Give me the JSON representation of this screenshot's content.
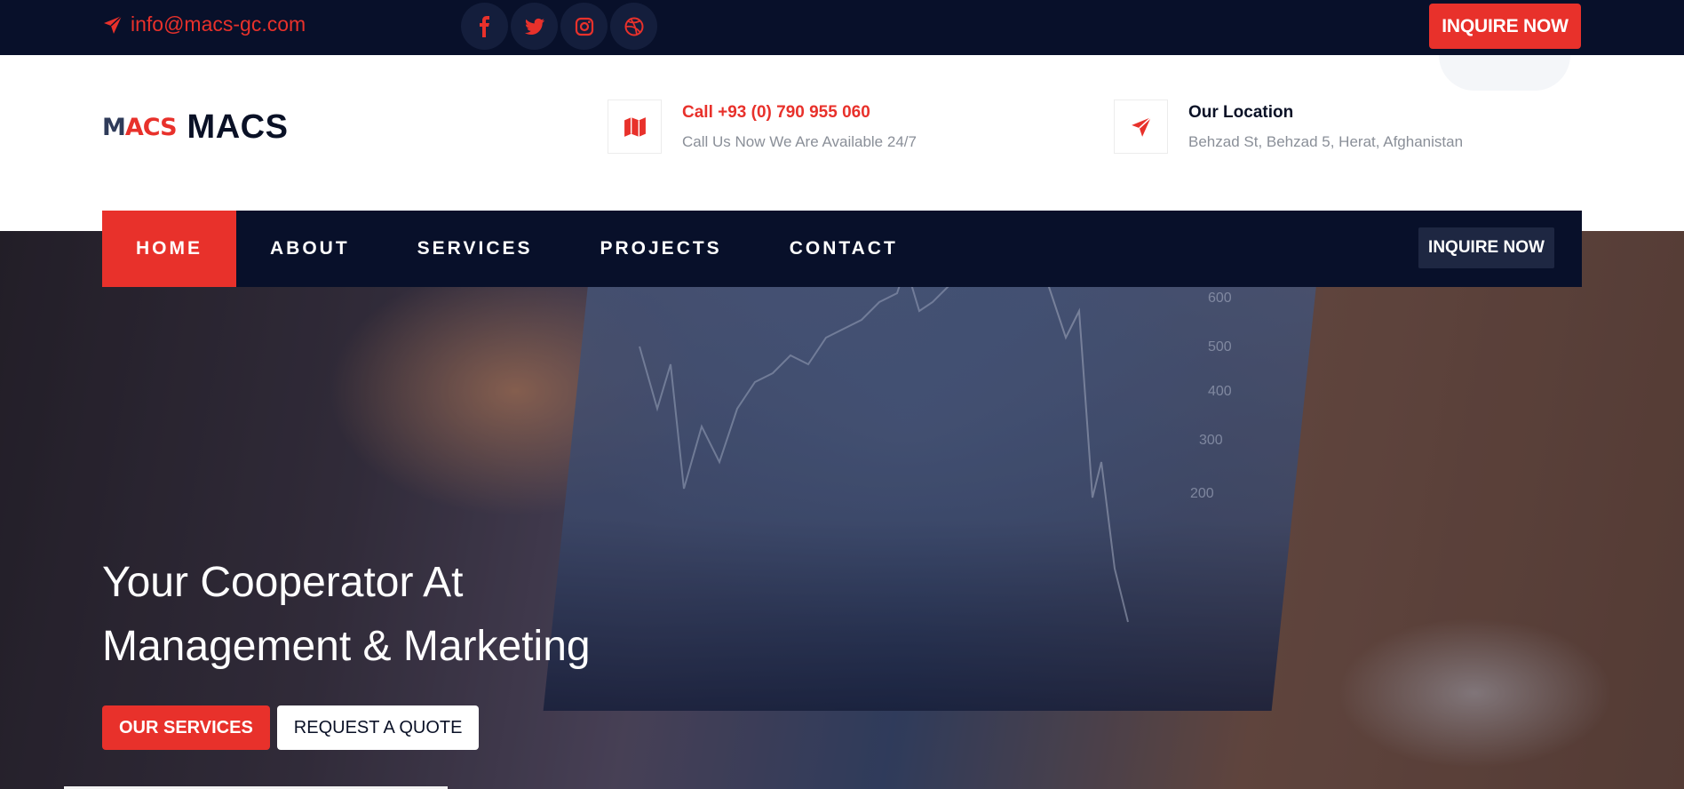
{
  "topbar": {
    "email": "info@macs-gc.com",
    "social_icons": [
      "facebook-icon",
      "twitter-icon",
      "instagram-icon",
      "dribbble-icon"
    ],
    "inquire_label": "INQUIRE NOW"
  },
  "header": {
    "logo_mark_m": "M",
    "logo_mark_acs": "ACS",
    "logo_text": "MACS",
    "call": {
      "icon": "map-icon",
      "title": "Call +93 (0) 790 955 060",
      "subtitle": "Call Us Now We Are Available 24/7"
    },
    "location": {
      "icon": "paper-plane-icon",
      "title": "Our Location",
      "subtitle": "Behzad St, Behzad 5, Herat, Afghanistan"
    }
  },
  "nav": {
    "items": [
      {
        "label": "HOME",
        "active": true
      },
      {
        "label": "ABOUT",
        "active": false
      },
      {
        "label": "SERVICES",
        "active": false
      },
      {
        "label": "PROJECTS",
        "active": false
      },
      {
        "label": "CONTACT",
        "active": false
      }
    ],
    "inquire_label": "INQUIRE NOW"
  },
  "hero": {
    "title_line1": "Your Cooperator At",
    "title_line2": "Management & Marketing",
    "services_label": "OUR SERVICES",
    "quote_label": "REQUEST A QUOTE"
  },
  "colors": {
    "accent": "#e8312b",
    "dark": "#08102a",
    "white": "#ffffff"
  }
}
